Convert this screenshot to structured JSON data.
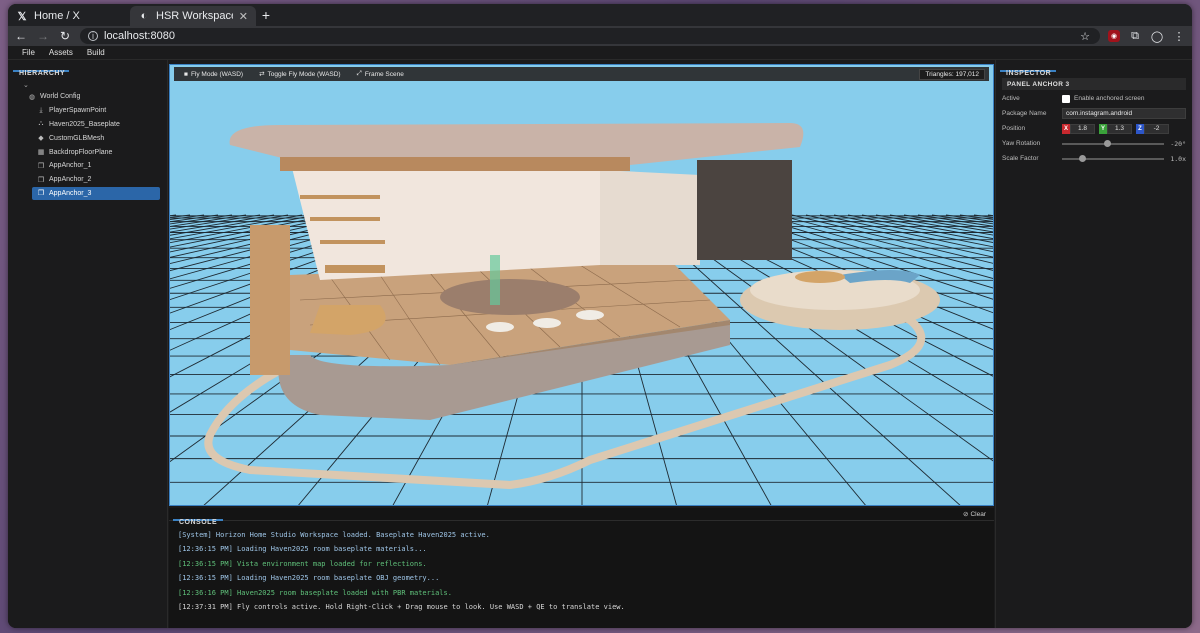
{
  "browser": {
    "tabs": [
      {
        "favicon": "𝕏",
        "title": "Home / X"
      },
      {
        "favicon": "◐",
        "title": "HSR Workspace - C"
      }
    ],
    "new_tab_label": "+",
    "url": "localhost:8080"
  },
  "menu": {
    "items": [
      "File",
      "Assets",
      "Build"
    ]
  },
  "hierarchy": {
    "title": "HIERARCHY",
    "toggle": "⌄",
    "root": "World Config",
    "items": [
      {
        "label": "PlayerSpawnPoint",
        "icon": "download-icon"
      },
      {
        "label": "Haven2025_Baseplate",
        "icon": "cubes-icon"
      },
      {
        "label": "CustomGLBMesh",
        "icon": "cube-icon"
      },
      {
        "label": "BackdropFloorPlane",
        "icon": "plane-icon"
      },
      {
        "label": "AppAnchor_1",
        "icon": "clone-icon"
      },
      {
        "label": "AppAnchor_2",
        "icon": "clone-icon"
      },
      {
        "label": "AppAnchor_3",
        "icon": "clone-icon",
        "selected": true
      }
    ]
  },
  "viewport": {
    "fly_mode": "Fly Mode (WASD)",
    "toggle_fly": "Toggle Fly Mode (WASD)",
    "frame_scene": "Frame Scene",
    "triangles": "Triangles: 197,012",
    "sky_color": "#87cdec",
    "grid_color": "#1e2a33"
  },
  "console": {
    "title": "CONSOLE",
    "clear_label": "Clear",
    "lines": [
      {
        "text": "[System] Horizon Home Studio Workspace loaded. Baseplate Haven2025 active.",
        "color": "#9fc6e8"
      },
      {
        "text": "[12:36:15 PM] Loading Haven2025 room baseplate materials...",
        "color": "#9fc6e8"
      },
      {
        "text": "[12:36:15 PM] Vista environment map loaded for reflections.",
        "color": "#5fc07a"
      },
      {
        "text": "[12:36:15 PM] Loading Haven2025 room baseplate OBJ geometry...",
        "color": "#9fc6e8"
      },
      {
        "text": "[12:36:16 PM] Haven2025 room baseplate loaded with PBR materials.",
        "color": "#5fc07a"
      },
      {
        "text": "[12:37:31 PM] Fly controls active. Hold Right-Click + Drag mouse to look. Use WASD + QE to translate view.",
        "color": "#d6d6d6"
      }
    ]
  },
  "inspector": {
    "title": "INSPECTOR",
    "panel_title": "PANEL ANCHOR 3",
    "active_label": "Active",
    "active_checkbox_label": "Enable anchored screen",
    "package_label": "Package Name",
    "package_value": "com.instagram.android",
    "position_label": "Position",
    "position": {
      "x": "1.8",
      "y": "1.3",
      "z": "-2"
    },
    "yaw_label": "Yaw Rotation",
    "yaw_value": "-20°",
    "yaw_fraction": 0.44,
    "scale_label": "Scale Factor",
    "scale_value": "1.0x",
    "scale_fraction": 0.2,
    "axis_colors": {
      "x": "#c8282e",
      "y": "#3aa23a",
      "z": "#2d56c8"
    }
  }
}
